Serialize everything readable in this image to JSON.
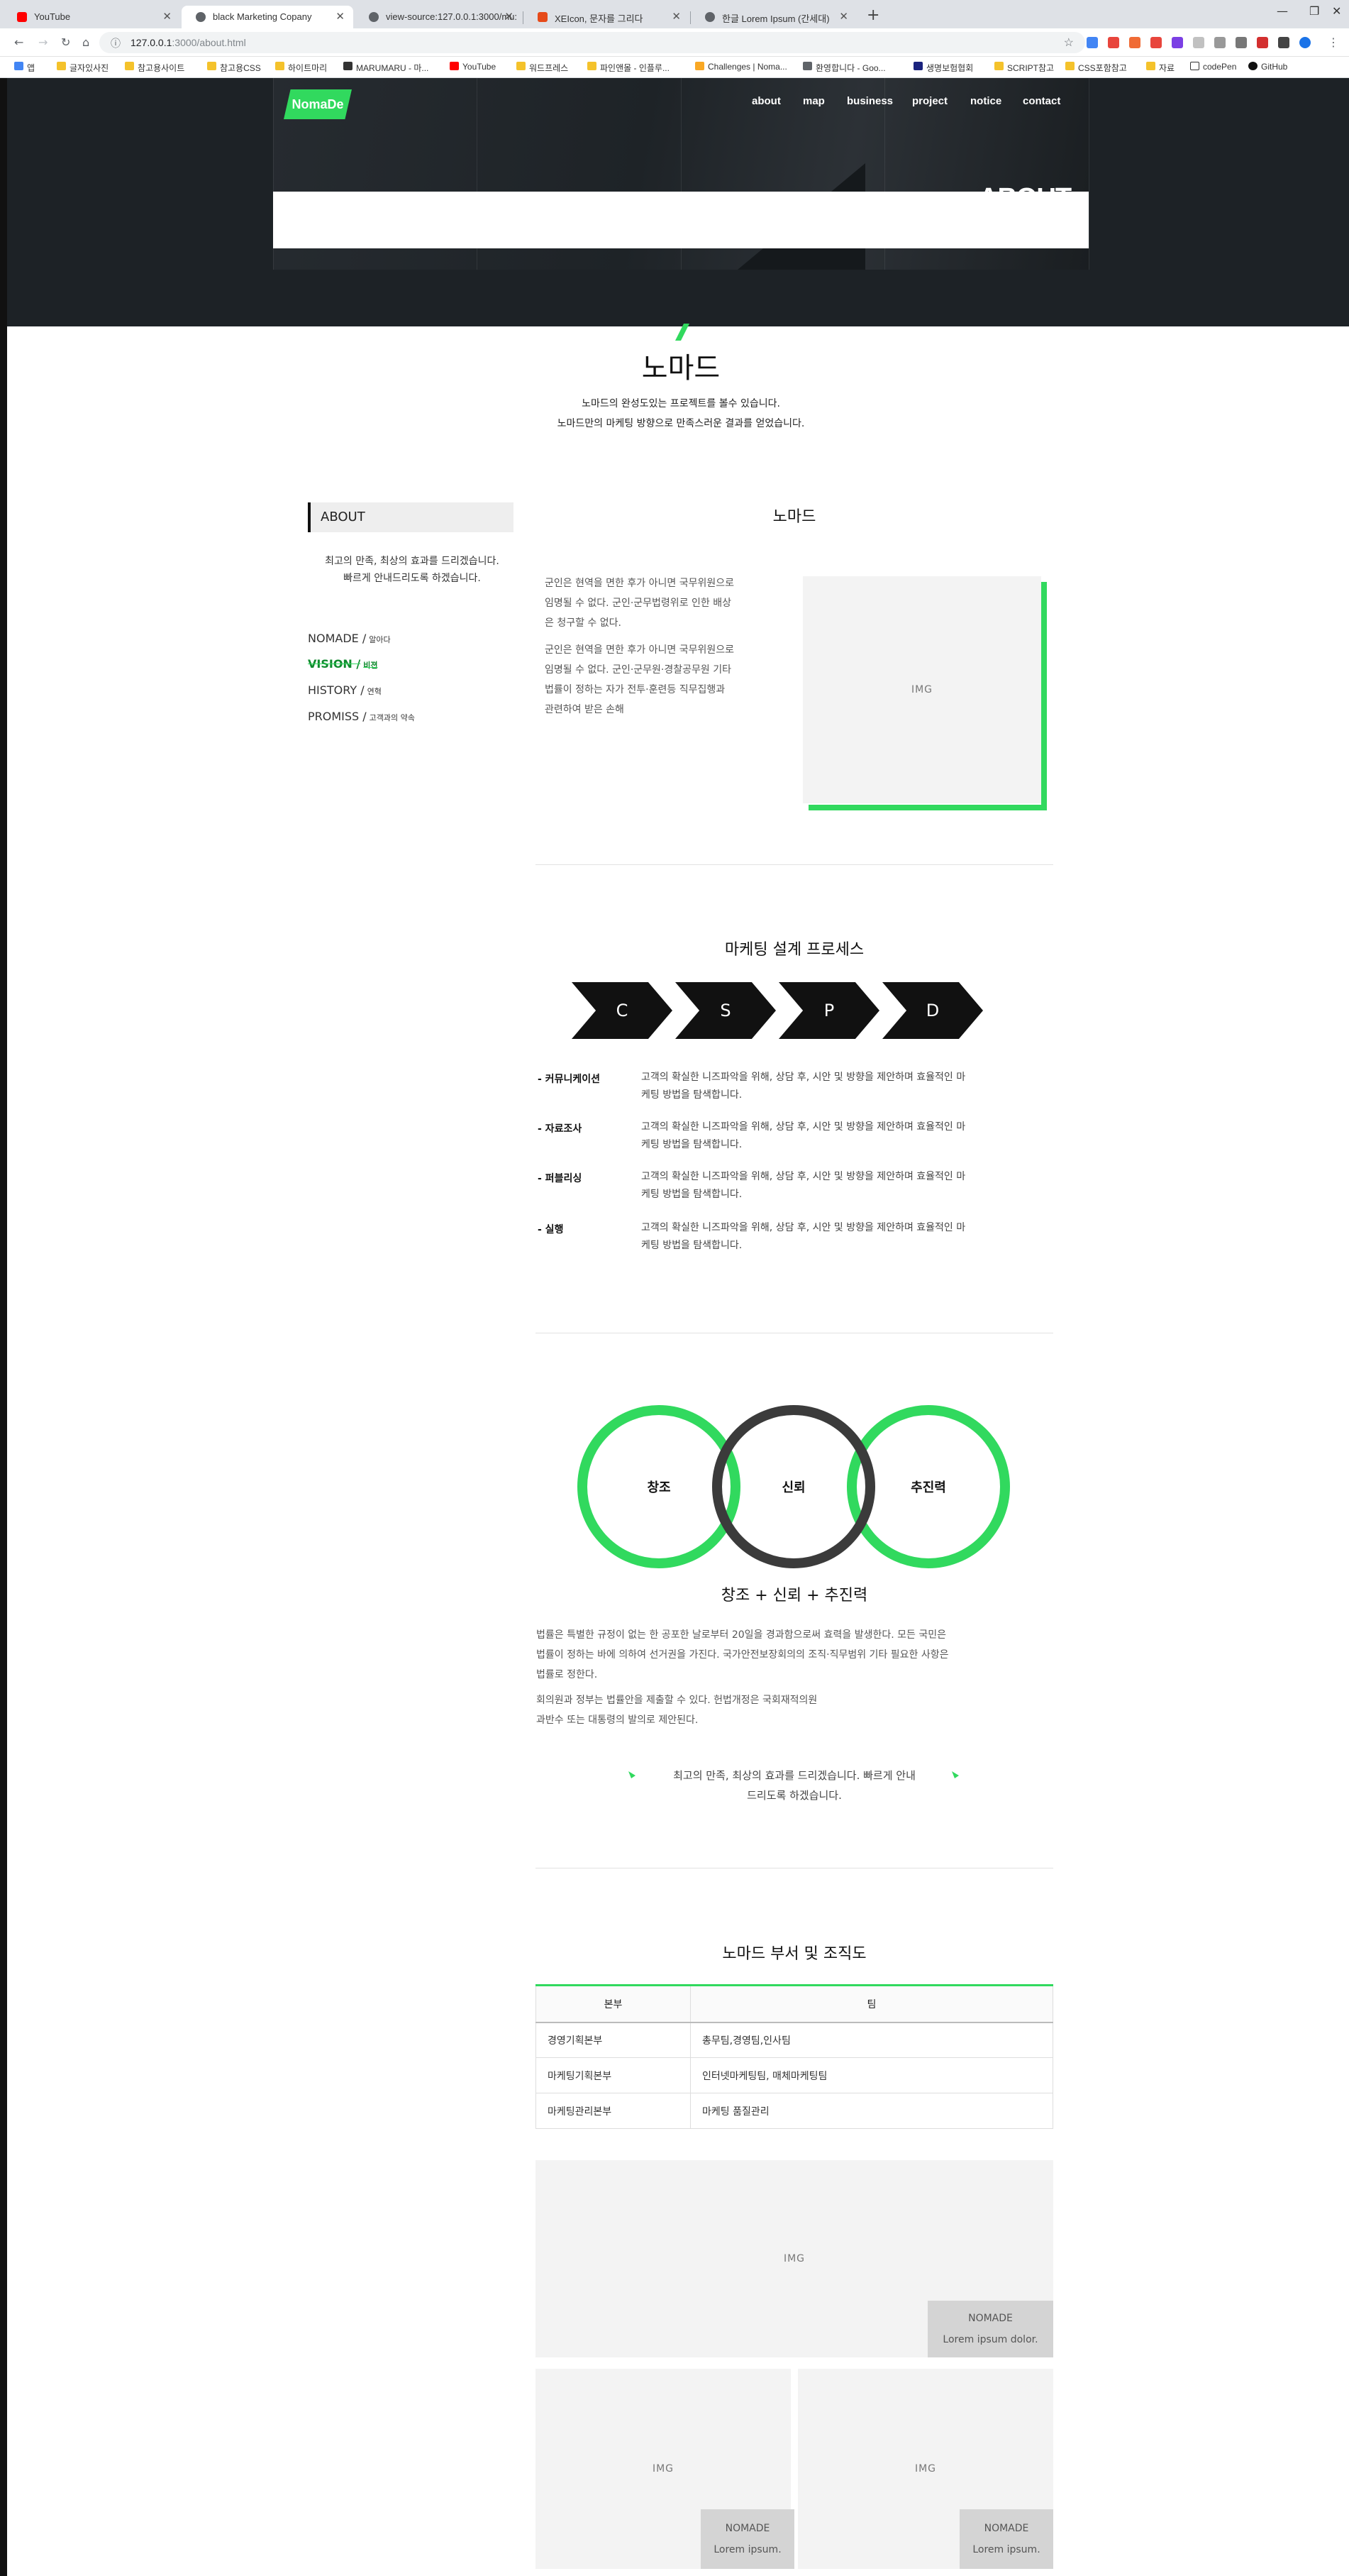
{
  "browser": {
    "tabs": [
      {
        "title": "YouTube",
        "active": false,
        "favicon_color": "#ff0000"
      },
      {
        "title": "black Marketing Copany",
        "active": true,
        "favicon_color": "#5f6368"
      },
      {
        "title": "view-source:127.0.0.1:3000/mu:",
        "active": false,
        "favicon_color": "#5f6368"
      },
      {
        "title": "XEIcon, 문자를 그리다",
        "active": false,
        "favicon_color": "#e64a19"
      },
      {
        "title": "한글 Lorem Ipsum (간세대)",
        "active": false,
        "favicon_color": "#5f6368"
      }
    ],
    "new_tab": "+",
    "url_host": "127.0.0.1",
    "url_rest": ":3000/about.html",
    "bookmarks": [
      "앱",
      "글자있사진",
      "참고용사이트",
      "참고용CSS",
      "하이트마리",
      "MARUMARU - 마...",
      "YouTube",
      "워드프레스",
      "파인앤몰 - 인플루...",
      "Challenges | Noma...",
      "환영합니다 - Goo...",
      "생명보험협회",
      "SCRIPT참고",
      "CSS포함참고",
      "자료",
      "codePen",
      "GitHub"
    ]
  },
  "header": {
    "logo": "NomaDe",
    "nav": [
      "about",
      "map",
      "business",
      "project",
      "notice",
      "contact"
    ],
    "title": "ABOUT"
  },
  "intro": {
    "title": "노마드",
    "line1": "노마드의 완성도있는 프로젝트를 볼수 있습니다.",
    "line2": "노마드만의 마케팅 방향으로 만족스러운 결과를 얻었습니다."
  },
  "sidebar": {
    "heading": "ABOUT",
    "desc1": "최고의 만족, 최상의 효과를 드리겠습니다.",
    "desc2": "빠르게 안내드리도록 하겠습니다.",
    "links": [
      {
        "label": "NOMADE /",
        "sub": "알아다"
      },
      {
        "label": "VISION /",
        "sub": "비젼"
      },
      {
        "label": "HISTORY /",
        "sub": "연혁"
      },
      {
        "label": "PROMISS /",
        "sub": "고객과의 약속"
      }
    ]
  },
  "about": {
    "title": "노마드",
    "para1": [
      "군인은 현역을 면한 후가 아니면 국무위원으로",
      "임명될 수 없다. 군인·군무법령위로 인한 배상",
      "은 청구할 수 없다."
    ],
    "para2": [
      "군인은 현역을 면한 후가 아니면 국무위원으로",
      "임명될 수 없다. 군인·군무원·경찰공무원 기타",
      "법률이 정하는 자가 전투·훈련등 직무집행과",
      "관련하여 받은 손해"
    ],
    "img": "IMG"
  },
  "process": {
    "title": "마케팅 설계 프로세스",
    "steps": [
      "C",
      "S",
      "P",
      "D"
    ],
    "items": [
      {
        "label": "- 커뮤니케이션",
        "desc1": "고객의 확실한 니즈파악을 위해, 상담 후, 시안 및 방향을 제안하며 효율적인 마",
        "desc2": "케팅 방법을 탐색합니다."
      },
      {
        "label": "- 자료조사",
        "desc1": "고객의 확실한 니즈파악을 위해, 상담 후, 시안 및 방향을 제안하며 효율적인 마",
        "desc2": "케팅 방법을 탐색합니다."
      },
      {
        "label": "- 퍼블리싱",
        "desc1": "고객의 확실한 니즈파악을 위해, 상담 후, 시안 및 방향을 제안하며 효율적인 마",
        "desc2": "케팅 방법을 탐색합니다."
      },
      {
        "label": "- 실행",
        "desc1": "고객의 확실한 니즈파악을 위해, 상담 후, 시안 및 방향을 제안하며 효율적인 마",
        "desc2": "케팅 방법을 탐색합니다."
      }
    ]
  },
  "values": {
    "circles": [
      "창조",
      "신뢰",
      "추진력"
    ],
    "title": "창조 + 신뢰 + 추진력",
    "para1": [
      "법률은 특별한 규정이 없는 한 공포한 날로부터 20일을 경과함으로써 효력을 발생한다. 모든 국민은",
      "법률이 정하는 바에 의하여 선거권을 가진다. 국가안전보장회의의 조직·직무범위 기타 필요한 사항은",
      "법률로 정한다."
    ],
    "para2": [
      "회의원과 정부는 법률안을 제출할 수 있다. 헌법개정은 국회재적의원",
      "과반수 또는 대통령의 발의로 제안된다."
    ],
    "quote1": "최고의 만족, 최상의 효과를 드리겠습니다. 빠르게 안내",
    "quote2": "드리도록 하겠습니다."
  },
  "org": {
    "title": "노마드 부서 및 조직도",
    "headers": [
      "본부",
      "팀"
    ],
    "rows": [
      [
        "경영기획본부",
        "총무팀,경영팀,인사팀"
      ],
      [
        "마케팅기획본부",
        "인터넷마케팅팀, 매체마케팅팀"
      ],
      [
        "마케팅관리본부",
        "마케팅 품질관리"
      ]
    ]
  },
  "gallery": {
    "img": "IMG",
    "tag_title": "NOMADE",
    "tag_text_wide": "Lorem ipsum dolor.",
    "tag_text_small": "Lorem ipsum."
  },
  "colors": {
    "accent": "#31d95e",
    "hero": "#1d2226"
  }
}
